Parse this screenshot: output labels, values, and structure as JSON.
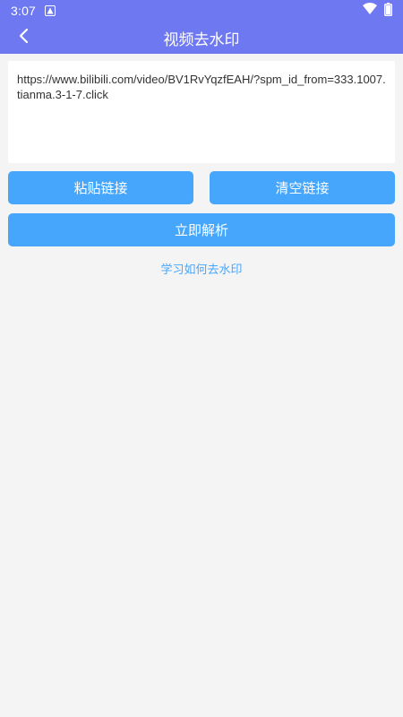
{
  "status_bar": {
    "time": "3:07",
    "notification_icon": "app-notification-icon",
    "wifi_icon": "wifi-icon",
    "battery_icon": "battery-icon"
  },
  "app_bar": {
    "title": "视频去水印",
    "back_icon": "chevron-left-icon"
  },
  "url_input": {
    "value": "https://www.bilibili.com/video/BV1RvYqzfEAH/?spm_id_from=333.1007.tianma.3-1-7.click"
  },
  "buttons": {
    "paste_label": "粘贴链接",
    "clear_label": "清空链接",
    "parse_label": "立即解析"
  },
  "learn_link": "学习如何去水印",
  "colors": {
    "header": "#6e78f0",
    "button": "#46a6fc",
    "link": "#46a6fc",
    "background": "#f4f4f4"
  }
}
